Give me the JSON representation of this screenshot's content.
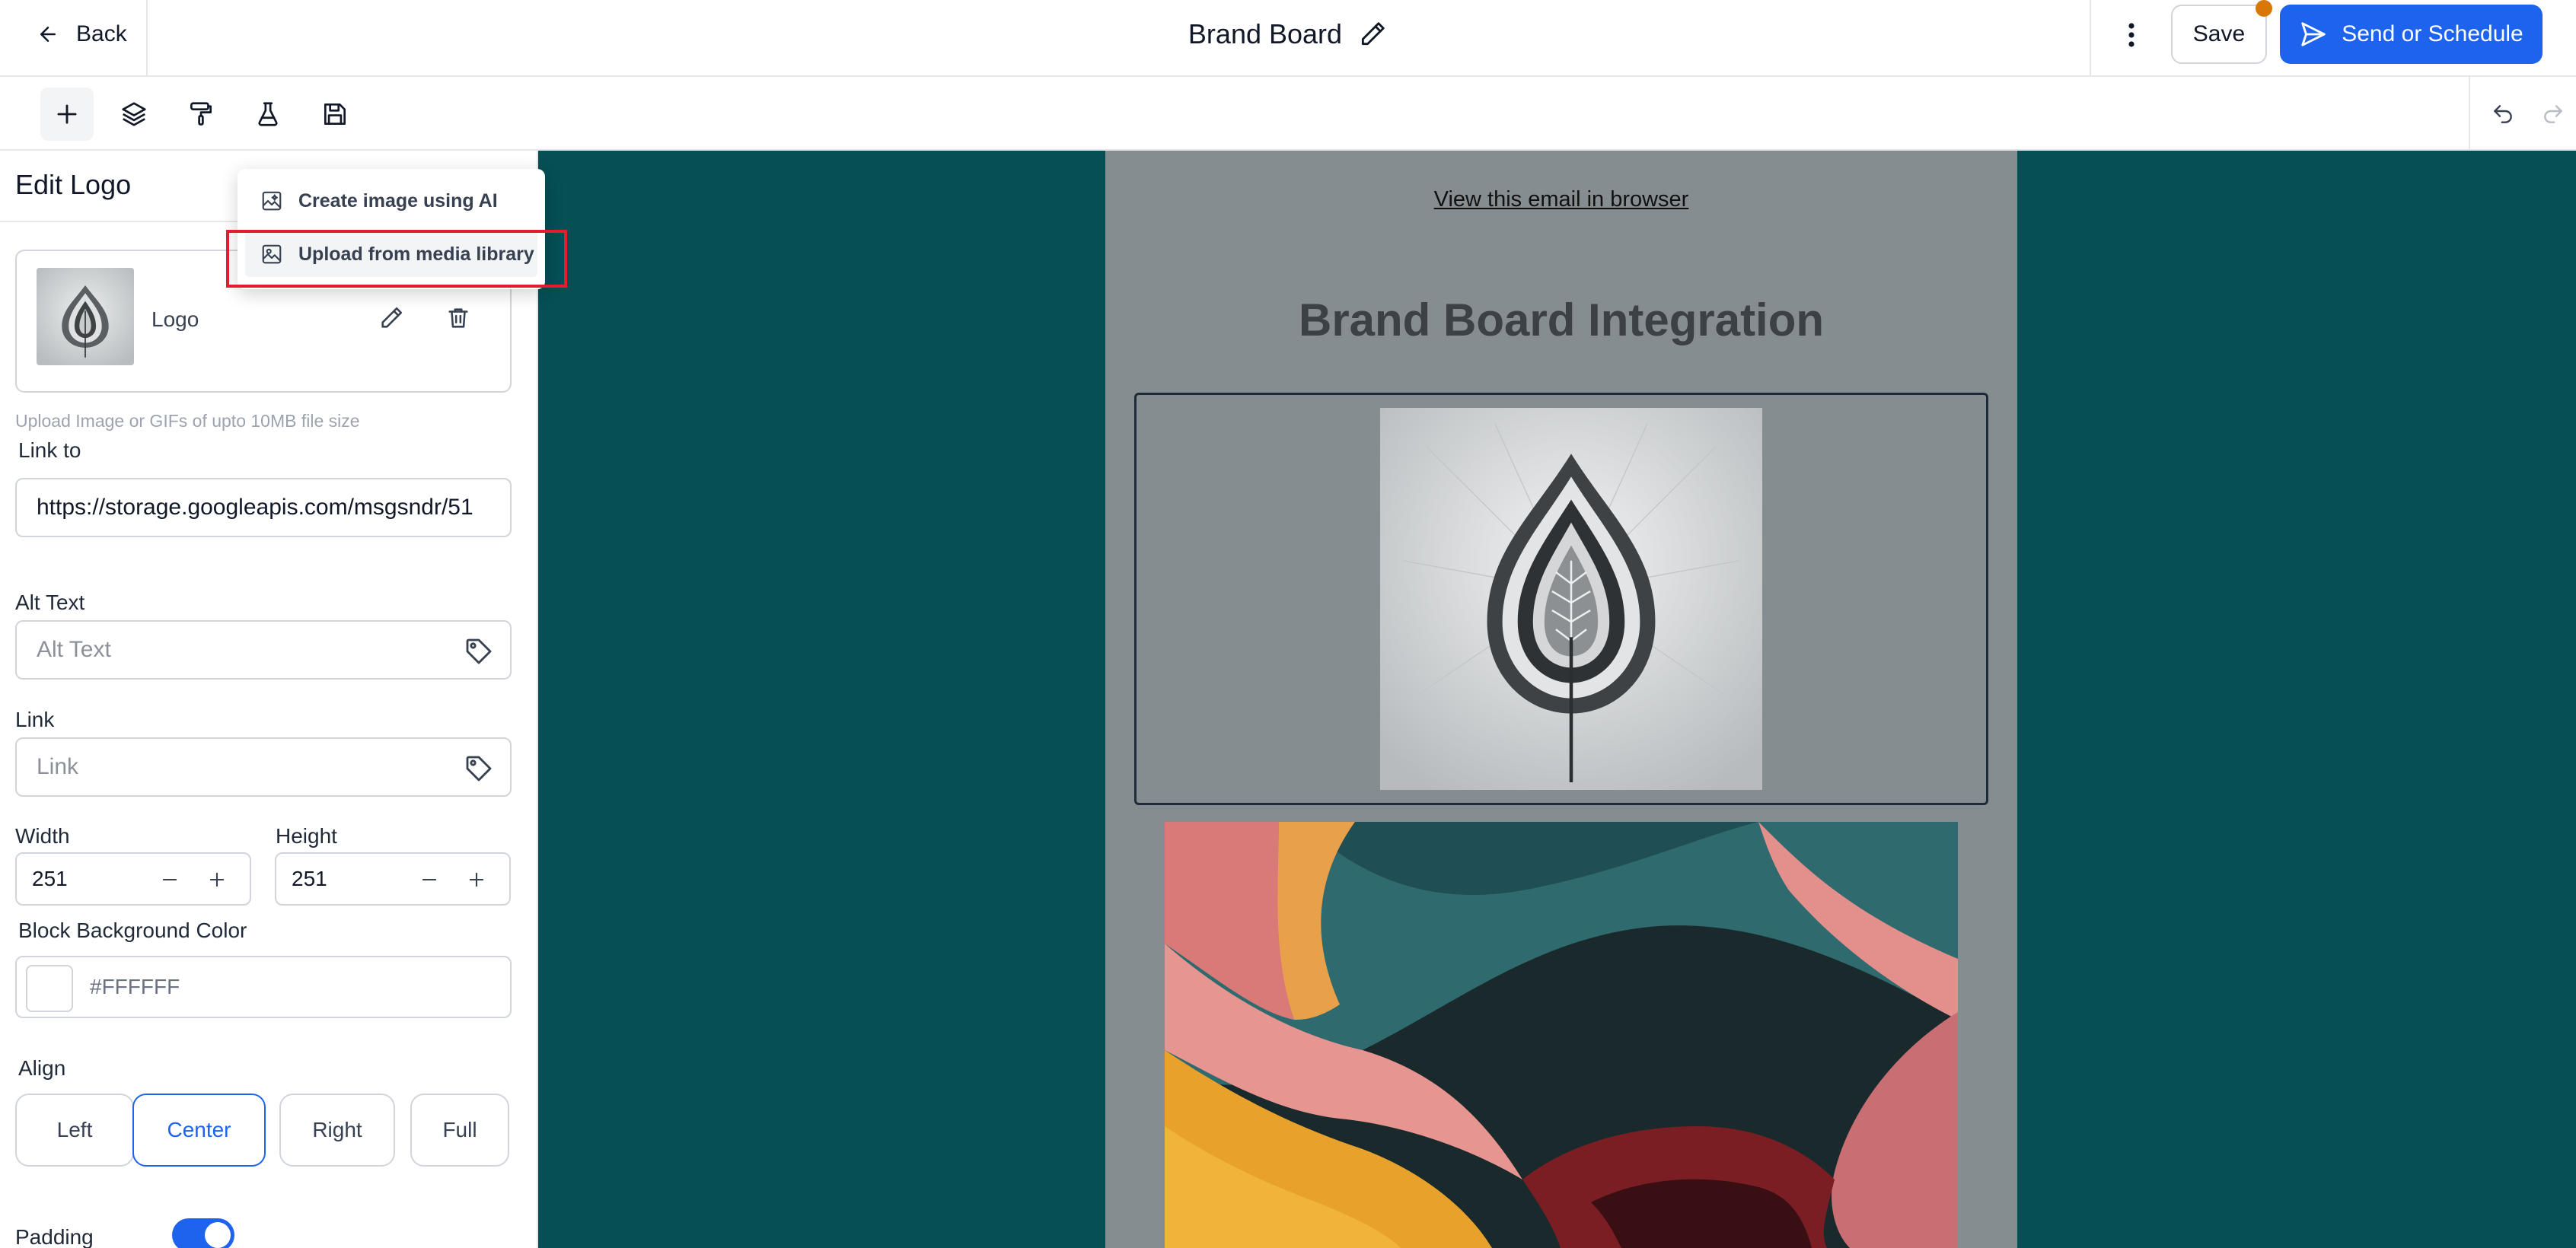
{
  "header": {
    "back_label": "Back",
    "doc_title": "Brand Board",
    "save_label": "Save",
    "send_label": "Send or Schedule"
  },
  "toolbar": {
    "tools": [
      "plus-icon",
      "layers-icon",
      "paint-roller-icon",
      "flask-icon",
      "floppy-disk-icon"
    ],
    "active_tool": "plus-icon"
  },
  "panel": {
    "title": "Edit Logo",
    "logo_name": "Logo",
    "upload_hint": "Upload Image or GIFs of upto 10MB file size",
    "link_to_label": "Link to",
    "link_to_value": "https://storage.googleapis.com/msgsndr/51",
    "alt_text_label": "Alt Text",
    "alt_text_placeholder": "Alt Text",
    "link_label": "Link",
    "link_placeholder": "Link",
    "width_label": "Width",
    "width_value": "251",
    "height_label": "Height",
    "height_value": "251",
    "bg_color_label": "Block Background Color",
    "bg_color_value": "#FFFFFF",
    "align_label": "Align",
    "align_options": [
      "Left",
      "Center",
      "Right",
      "Full"
    ],
    "align_selected": "Center",
    "padding_label": "Padding",
    "padding_enabled": true
  },
  "dropdown": {
    "items": [
      "Create image using AI",
      "Upload from media library"
    ],
    "highlighted": "Upload from media library"
  },
  "email": {
    "browser_link": "View this email in browser",
    "title": "Brand Board Integration"
  },
  "colors": {
    "accent": "#1d63ed",
    "canvas_bg": "#054f55",
    "email_bg": "#868d90",
    "notification_dot": "#d97706",
    "highlight_box": "#e11d2e"
  }
}
